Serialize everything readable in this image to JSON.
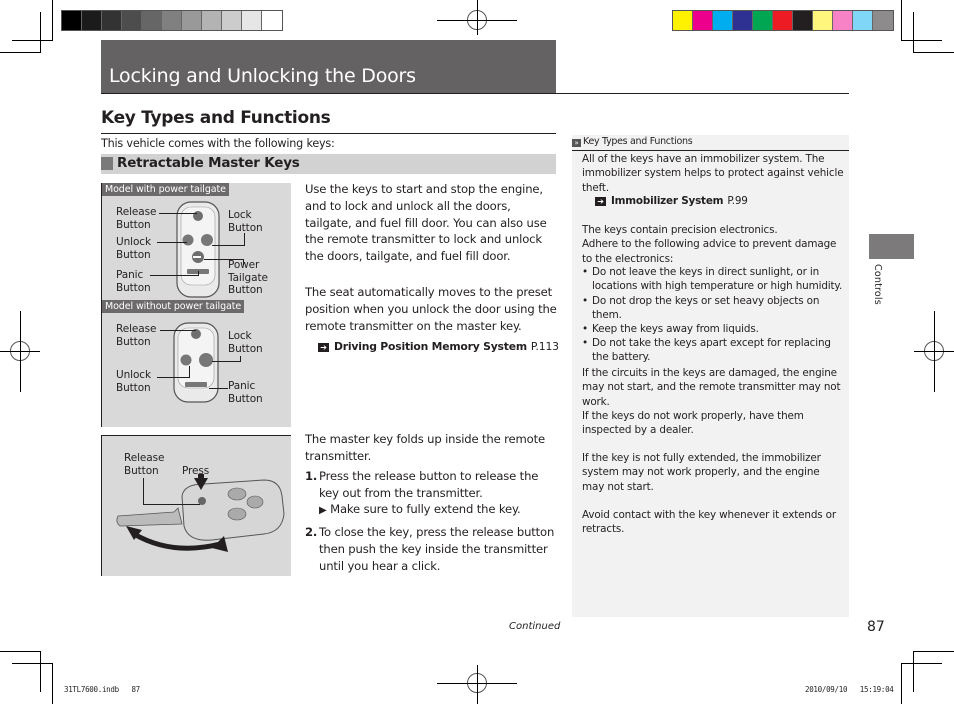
{
  "color_bars": {
    "grayscale": [
      "#000000",
      "#1b1b1b",
      "#333333",
      "#4d4d4d",
      "#666666",
      "#808080",
      "#999999",
      "#b3b3b3",
      "#cccccc",
      "#e6e6e6",
      "#ffffff"
    ],
    "process": [
      "#fff200",
      "#ec008c",
      "#00aeef",
      "#2e3192",
      "#00a651",
      "#ed1c24",
      "#231f20",
      "#fff77d",
      "#f783c6",
      "#7fd6f7",
      "#8d8b8c"
    ]
  },
  "header": {
    "chapter_title": "Locking and Unlocking the Doors"
  },
  "section": {
    "title": "Key Types and Functions",
    "intro": "This vehicle comes with the following keys:",
    "subsection": "Retractable Master Keys"
  },
  "figures": {
    "fig1": {
      "tag": "Model with power tailgate",
      "release": "Release\nButton",
      "unlock": "Unlock\nButton",
      "panic": "Panic\nButton",
      "lock": "Lock\nButton",
      "tailgate": "Power\nTailgate\nButton"
    },
    "fig2": {
      "tag": "Model without power tailgate",
      "release": "Release\nButton",
      "unlock": "Unlock\nButton",
      "lock": "Lock\nButton",
      "panic": "Panic\nButton"
    },
    "fig3": {
      "release": "Release\nButton",
      "press": "Press"
    }
  },
  "body": {
    "para1": "Use the keys to start and stop the engine, and to lock and unlock all the doors, tailgate, and fuel fill door. You can also use the remote transmitter to lock and unlock the doors, tailgate, and fuel fill door.",
    "para2": "The seat automatically moves to the preset position when you unlock the door using the remote transmitter on the master key.",
    "xref1": {
      "label": "Driving Position Memory System",
      "page": "P.113"
    },
    "para3": "The master key folds up inside the remote transmitter.",
    "steps": [
      {
        "num": "1.",
        "text": "Press the release button to release the key out from the transmitter.",
        "sub": "Make sure to fully extend the key."
      },
      {
        "num": "2.",
        "text": "To close the key, press the release button then push the key inside the transmitter until you hear a click."
      }
    ]
  },
  "notes": {
    "header": "Key Types and Functions",
    "p1": "All of the keys have an immobilizer system. The immobilizer system helps to protect against vehicle theft.",
    "xref": {
      "label": "Immobilizer System",
      "page": "P.99"
    },
    "p2": "The keys contain precision electronics.\nAdhere to the following advice to prevent damage to the electronics:",
    "bullets": [
      "Do not leave the keys in direct sunlight, or in locations with high temperature or high humidity.",
      "Do not drop the keys or set heavy objects on them.",
      "Keep the keys away from liquids.",
      "Do not take the keys apart except for replacing the battery."
    ],
    "p3": "If the circuits in the keys are damaged, the engine may not start, and the remote transmitter may not work.\nIf the keys do not work properly, have them inspected by a dealer.",
    "p4": "If the key is not fully extended, the immobilizer system may not work properly, and the engine may not start.",
    "p5": "Avoid contact with the key whenever it extends or retracts."
  },
  "thumb_tab": {
    "label": "Controls"
  },
  "footer": {
    "continued": "Continued",
    "page_number": "87",
    "slug_file": "31TL7600.indb   87",
    "slug_date": "2010/09/10   15:19:04"
  }
}
